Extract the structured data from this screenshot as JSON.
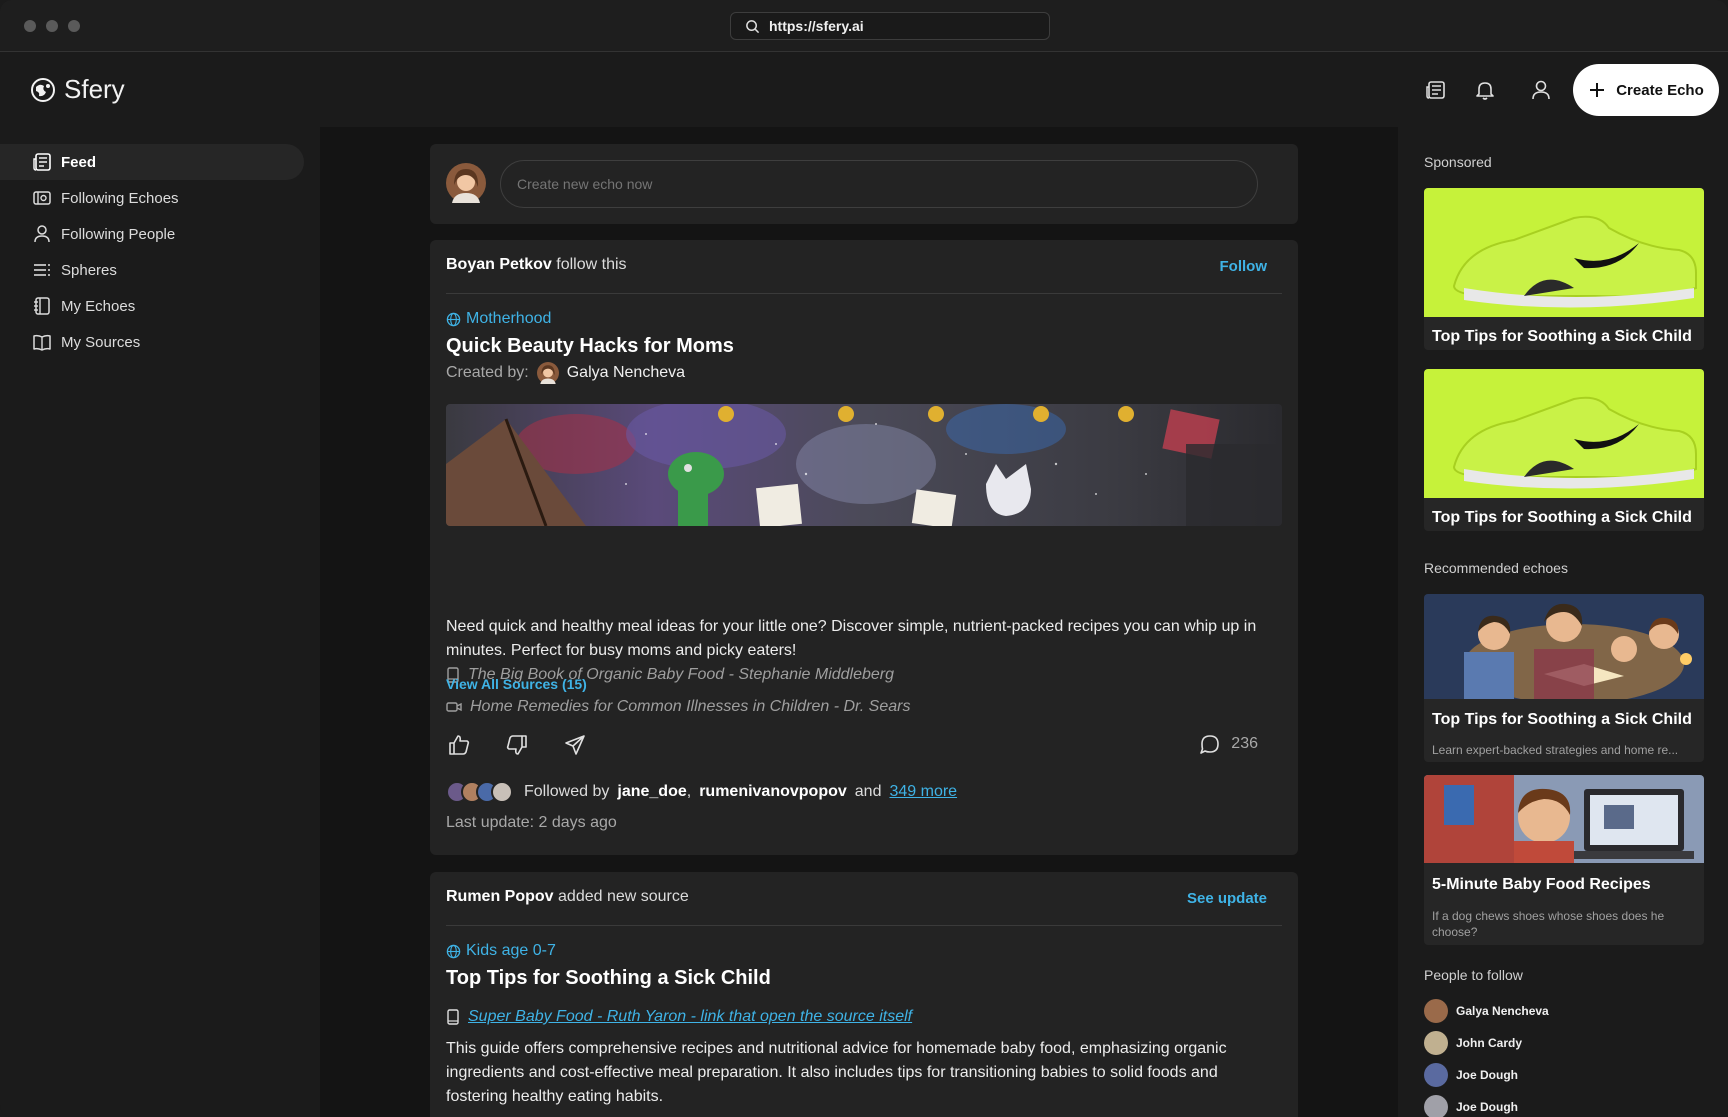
{
  "browser": {
    "url": "https://sfery.ai"
  },
  "app": {
    "name": "Sfery",
    "create_label": "Create Echo"
  },
  "nav": [
    {
      "label": "Feed",
      "icon": "feed-icon",
      "active": true
    },
    {
      "label": "Following Echoes",
      "icon": "ticket-icon"
    },
    {
      "label": "Following People",
      "icon": "person-icon"
    },
    {
      "label": "Spheres",
      "icon": "list-icon"
    },
    {
      "label": "My Echoes",
      "icon": "notebook-icon"
    },
    {
      "label": "My Sources",
      "icon": "book-icon"
    }
  ],
  "composer": {
    "placeholder": "Create new echo now"
  },
  "posts": [
    {
      "actor": "Boyan Petkov",
      "activity": "follow this",
      "action": "Follow",
      "sphere": "Motherhood",
      "title": "Quick Beauty Hacks for Moms",
      "created_by_label": "Created by:",
      "author": "Galya Nencheva",
      "description": "Need quick and healthy meal ideas for your little one? Discover simple, nutrient-packed recipes you can whip up in minutes. Perfect for busy moms and picky eaters!",
      "sources": [
        {
          "type": "book-icon",
          "text": "The Big Book of Organic Baby Food - Stephanie Middleberg"
        },
        {
          "type": "video-icon",
          "text": "Home Remedies for Common Illnesses in Children - Dr. Sears"
        }
      ],
      "view_all": "View All Sources (15)",
      "comments": "236",
      "followed_prefix": "Followed by",
      "followers": [
        "jane_doe",
        "rumenivanovpopov"
      ],
      "and": "and",
      "more": "349 more",
      "last_update": "Last update: 2 days ago"
    },
    {
      "actor": "Rumen Popov",
      "activity": "added new source",
      "action": "See update",
      "sphere": "Kids age 0-7",
      "title": "Top Tips for Soothing a Sick Child",
      "sources": [
        {
          "type": "book-icon",
          "text": "Super Baby Food - Ruth Yaron - link that open the source itself"
        }
      ],
      "description": "This guide offers comprehensive recipes and nutritional advice for homemade baby food, emphasizing organic ingredients and cost-effective meal preparation. It also includes tips for transitioning babies to solid foods and fostering healthy eating habits."
    }
  ],
  "right": {
    "sponsored_label": "Sponsored",
    "sponsored": [
      {
        "title": "Top Tips for Soothing a Sick Child"
      },
      {
        "title": "Top Tips for Soothing a Sick Child"
      }
    ],
    "recommended_label": "Recommended echoes",
    "recommended": [
      {
        "title": "Top Tips for Soothing a Sick Child",
        "subtitle": "Learn expert-backed strategies and home re..."
      },
      {
        "title": "5-Minute Baby Food Recipes",
        "subtitle": "If a dog chews shoes whose shoes does he choose?"
      }
    ],
    "people_label": "People to follow",
    "people": [
      "Galya Nencheva",
      "John Cardy",
      "Joe Dough",
      "Joe Dough"
    ]
  },
  "colors": {
    "accent": "#3fb3e6",
    "background": "#1b1b1b",
    "card": "#232323"
  }
}
